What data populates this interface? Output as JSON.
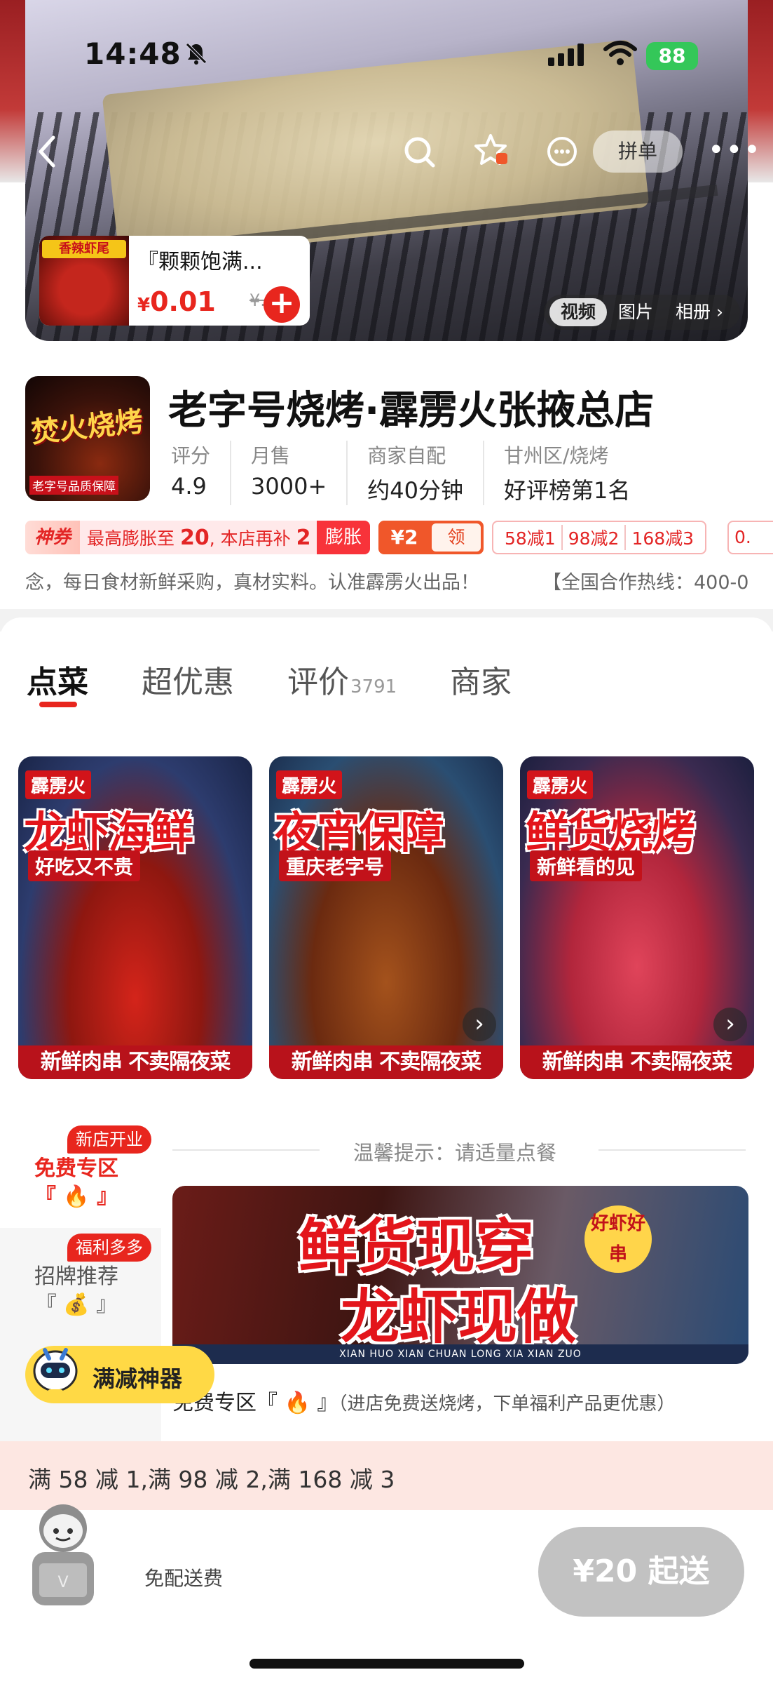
{
  "status_bar": {
    "time": "14:48",
    "battery": "88"
  },
  "hero": {
    "pin_label": "拼单",
    "mini_card": {
      "thumb_label": "香辣虾尾",
      "title": "『颗颗饱满...",
      "currency": "¥",
      "price": "0.01",
      "orig_price": "¥..."
    },
    "media_tabs": [
      "视频",
      "图片",
      "相册"
    ]
  },
  "shop": {
    "logo_text": "焚火烧烤",
    "logo_sub": "老字号品质保障",
    "name": "老字号烧烤·霹雳火张掖总店",
    "stats": [
      {
        "label": "评分",
        "value": "4.9"
      },
      {
        "label": "月售",
        "value": "3000+"
      },
      {
        "label": "商家自配",
        "value": "约40分钟"
      },
      {
        "label": "甘州区/烧烤",
        "value": "好评榜第1名"
      }
    ],
    "coupon": {
      "tag": "神券",
      "text_prefix": "最高膨胀至",
      "amount1": "20",
      "text_mid": ", 本店再补",
      "amount2": "2",
      "button": "膨胀"
    },
    "coupon_small": {
      "amount": "¥2",
      "button": "领"
    },
    "discounts": [
      "58减1",
      "98减2",
      "168减3"
    ],
    "discount_more": "0.",
    "notice": "念，每日食材新鲜采购，真材实料。认准霹雳火出品！",
    "hotline": "【全国合作热线：400-0"
  },
  "tabs": [
    {
      "label": "点菜",
      "count": ""
    },
    {
      "label": "超优惠",
      "count": ""
    },
    {
      "label": "评价",
      "count": "3791"
    },
    {
      "label": "商家",
      "count": ""
    }
  ],
  "banners": [
    {
      "brand": "霹雳火",
      "title": "龙虾海鲜",
      "sub": "好吃又不贵",
      "footer": "新鲜肉串 不卖隔夜菜"
    },
    {
      "brand": "霹雳火",
      "title": "夜宵保障",
      "sub": "重庆老字号",
      "footer": "新鲜肉串 不卖隔夜菜"
    },
    {
      "brand": "霹雳火",
      "title": "鲜货烧烤",
      "sub": "新鲜看的见",
      "footer": "新鲜肉串 不卖隔夜菜"
    }
  ],
  "sidebar": [
    {
      "badge": "新店开业",
      "label": "免费专区",
      "emoji": "『 🔥 』"
    },
    {
      "badge": "福利多多",
      "label": "招牌推荐",
      "emoji": "『 💰 』"
    }
  ],
  "tip": "温馨提示：请适量点餐",
  "promo": {
    "line1": "鲜货现穿",
    "line2": "龙虾现做",
    "badge": "好虾好串",
    "footer": "XIAN HUO XIAN CHUAN LONG XIA XIAN ZUO"
  },
  "section": {
    "title": "免费专区『 🔥 』",
    "desc": "（进店免费送烧烤，下单福利产品更优惠）"
  },
  "helper": {
    "label": "满减神器"
  },
  "reduce_bar": "满 58 减 1,满 98 减 2,满 168 减 3",
  "cart": {
    "delivery": "免配送费",
    "start_button": "¥20 起送"
  }
}
